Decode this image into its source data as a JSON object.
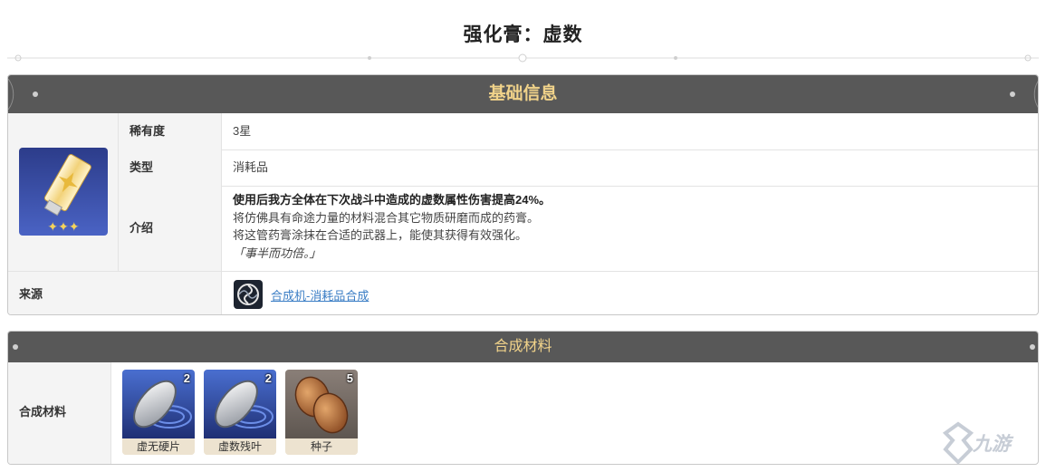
{
  "page": {
    "title": "强化膏：虚数"
  },
  "info": {
    "header": "基础信息",
    "item_icon": "ointment-tube-icon",
    "rarity_stars": 3,
    "rows": {
      "rarity": {
        "label": "稀有度",
        "value": "3星"
      },
      "type": {
        "label": "类型",
        "value": "消耗品"
      },
      "intro": {
        "label": "介绍",
        "line1": "使用后我方全体在下次战斗中造成的虚数属性伤害提高24%。",
        "line2": "将仿佛具有命途力量的材料混合其它物质研磨而成的药膏。",
        "line3": "将这管药膏涂抹在合适的武器上，能使其获得有效强化。",
        "line4": "「事半而功倍。」"
      }
    },
    "source": {
      "label": "来源",
      "icon": "synthesizer-icon",
      "link_text": "合成机-消耗品合成"
    }
  },
  "craft": {
    "header": "合成材料",
    "label": "合成材料",
    "materials": [
      {
        "name": "虚无硬片",
        "count": "2",
        "icon": "void-shard-icon"
      },
      {
        "name": "虚数残叶",
        "count": "2",
        "icon": "imaginary-leaf-icon"
      },
      {
        "name": "种子",
        "count": "5",
        "icon": "seed-icon"
      }
    ]
  },
  "watermark": {
    "text": "九游"
  },
  "colors": {
    "header_bg": "#585858",
    "header_text": "#f1d38a",
    "link": "#3b7ec5",
    "label_bg": "#f4f4f4"
  }
}
